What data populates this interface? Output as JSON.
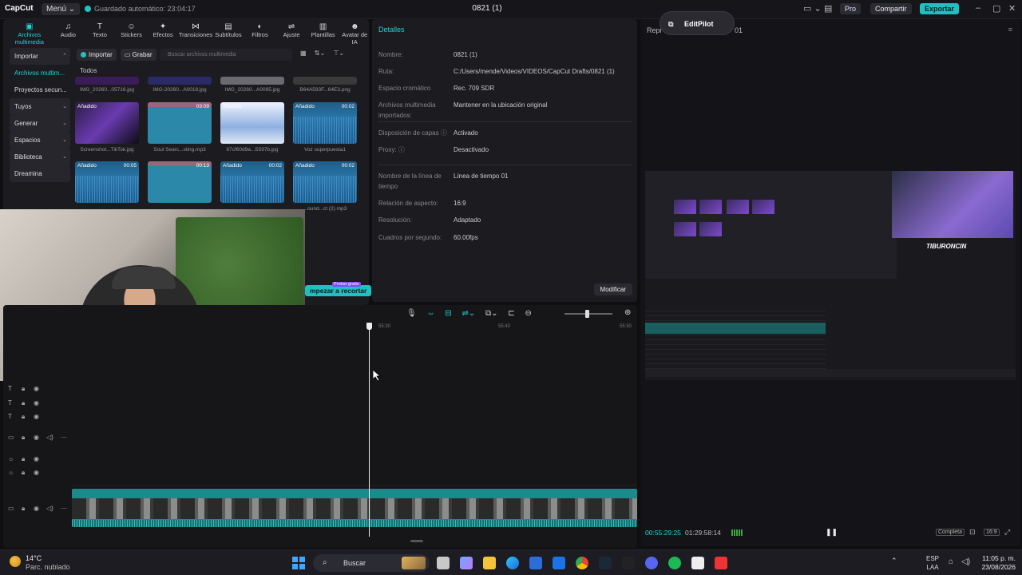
{
  "topbar": {
    "logo": "CapCut",
    "menu": "Menú ⌄",
    "autosave": "Guardado automático: 23:04:17",
    "title": "0821 (1)",
    "pro": "Pro",
    "share": "Compartir",
    "export": "Exportar"
  },
  "tools": [
    {
      "icon": "▣",
      "label": "Archivos multimedia"
    },
    {
      "icon": "♫",
      "label": "Audio"
    },
    {
      "icon": "T",
      "label": "Texto"
    },
    {
      "icon": "☺",
      "label": "Stickers"
    },
    {
      "icon": "✦",
      "label": "Efectos"
    },
    {
      "icon": "⋈",
      "label": "Transiciones"
    },
    {
      "icon": "▤",
      "label": "Subtítulos"
    },
    {
      "icon": "◐",
      "label": "Filtros"
    },
    {
      "icon": "⇌",
      "label": "Ajuste"
    },
    {
      "icon": "▥",
      "label": "Plantillas"
    },
    {
      "icon": "☻",
      "label": "Avatar de IA"
    }
  ],
  "side": [
    {
      "label": "Importar",
      "chev": "⌃"
    },
    {
      "label": "Archivos multim..."
    },
    {
      "label": "Proyectos secun..."
    },
    {
      "label": "Tuyos",
      "chev": "⌄"
    },
    {
      "label": "Generar",
      "chev": "⌄"
    },
    {
      "label": "Espacios",
      "chev": "⌄"
    },
    {
      "label": "Biblioteca",
      "chev": "⌄"
    },
    {
      "label": "Dreamina"
    }
  ],
  "media": {
    "import_btn": "Importar",
    "record_btn": "Grabar",
    "search_placeholder": "Buscar archivos multimedia",
    "todos": "Todos",
    "row0": [
      {
        "caption": "IMG_20260...05716.jpg"
      },
      {
        "caption": "IMG-20260...A0018.jpg"
      },
      {
        "caption": "IMG_20260...A0095.jpg"
      },
      {
        "caption": "B64A593F...64E3.png"
      }
    ],
    "row1": [
      {
        "tag": "Añadido",
        "dur": "",
        "caption": "Screenshot...TikTok.jpg"
      },
      {
        "tag": "",
        "dur": "03:09",
        "caption": "Soul Searc...sting.mp3"
      },
      {
        "tag": "Añadido",
        "dur": "",
        "caption": "67cf60d9a...S597b.jpg"
      },
      {
        "tag": "Añadido",
        "dur": "00:02",
        "caption": "Voz superpuesta1"
      }
    ],
    "row2": [
      {
        "tag": "Añadido",
        "dur": "00:05",
        "caption": ""
      },
      {
        "tag": "",
        "dur": "00:13",
        "caption": ""
      },
      {
        "tag": "Añadido",
        "dur": "00:02",
        "caption": ""
      },
      {
        "tag": "Añadido",
        "dur": "00:02",
        "caption": "...ound...ct (2).mp3"
      }
    ]
  },
  "empezar": "mpezar a recortar",
  "probar": "Probar gratis",
  "details": {
    "header": "Detalles",
    "rows": [
      {
        "k": "Nombre:",
        "v": "0821 (1)"
      },
      {
        "k": "Ruta:",
        "v": "C:/Users/mende/Videos/VIDEOS/CapCut Drafts/0821 (1)"
      },
      {
        "k": "Espacio cromático",
        "v": "Rec. 709 SDR"
      },
      {
        "k": "Archivos multimedia importados:",
        "v": "Mantener en la ubicación original"
      },
      {
        "k": "Disposición de capas ⓘ",
        "v": "Activado"
      },
      {
        "k": "Proxy: ⓘ",
        "v": "Desactivado"
      },
      {
        "k": "Nombre de la línea de tiempo",
        "v": "Línea de tiempo 01"
      },
      {
        "k": "Relación de aspecto:",
        "v": "16:9"
      },
      {
        "k": "Resolución:",
        "v": "Adaptado"
      },
      {
        "k": "Cuadros por segundo:",
        "v": "60.00fps"
      }
    ],
    "modify": "Modificar"
  },
  "player": {
    "label": "Repr",
    "num": "01",
    "editpilot": "EditPilot",
    "overlay_logo": "TIBURONCIN",
    "time_current": "00:55:29:25",
    "time_total": "01:29:58:14",
    "full": "Completa",
    "ratio": "16:9"
  },
  "timeline": {
    "ruler": [
      "55:30",
      "55:40",
      "55:50"
    ]
  },
  "taskbar": {
    "temp": "14°C",
    "weather": "Parc. nublado",
    "search": "Buscar",
    "lang1": "ESP",
    "lang2": "LAA",
    "time": "11:05 p. m.",
    "date": "23/08/2026"
  }
}
